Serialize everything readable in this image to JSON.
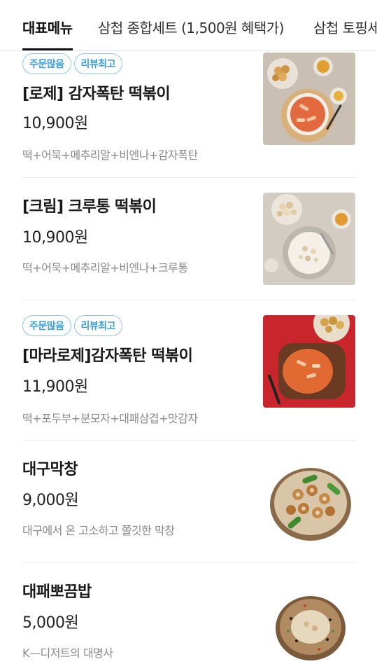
{
  "tabs": [
    {
      "label": "대표메뉴",
      "active": true
    },
    {
      "label": "삼첩 종합세트 (1,500원 혜택가)",
      "active": false
    },
    {
      "label": "삼첩 토핑세트",
      "active": false
    }
  ],
  "items": [
    {
      "badges": [
        "주문많음",
        "리뷰최고"
      ],
      "name": "[로제] 감자폭탄 떡볶이",
      "price": "10,900원",
      "desc": "떡+어묵+메추리알+비엔나+감자폭탄",
      "image": "rose-tteokbokki-photo"
    },
    {
      "badges": [],
      "name": "[크림] 크루통 떡볶이",
      "price": "10,900원",
      "desc": "떡+어묵+메추리알+비엔나+크루통",
      "image": "cream-tteokbokki-photo"
    },
    {
      "badges": [
        "주문많음",
        "리뷰최고"
      ],
      "name": "[마라로제]감자폭탄 떡볶이",
      "price": "11,900원",
      "desc": "떡+포두부+분모자+대패삼겹+맛감자",
      "image": "mala-rose-tteokbokki-photo"
    },
    {
      "badges": [],
      "name": "대구막창",
      "price": "9,000원",
      "desc": "대구에서 온 고소하고 쫄깃한 막창",
      "image": "daegu-makchang-photo"
    },
    {
      "badges": [],
      "name": "대패뽀끔밥",
      "price": "5,000원",
      "desc": "K—디저트의 대명사",
      "image": "fried-rice-photo"
    }
  ],
  "colors": {
    "badge": "#3aa0d8",
    "active_tab": "#111111",
    "divider": "#ececec"
  }
}
